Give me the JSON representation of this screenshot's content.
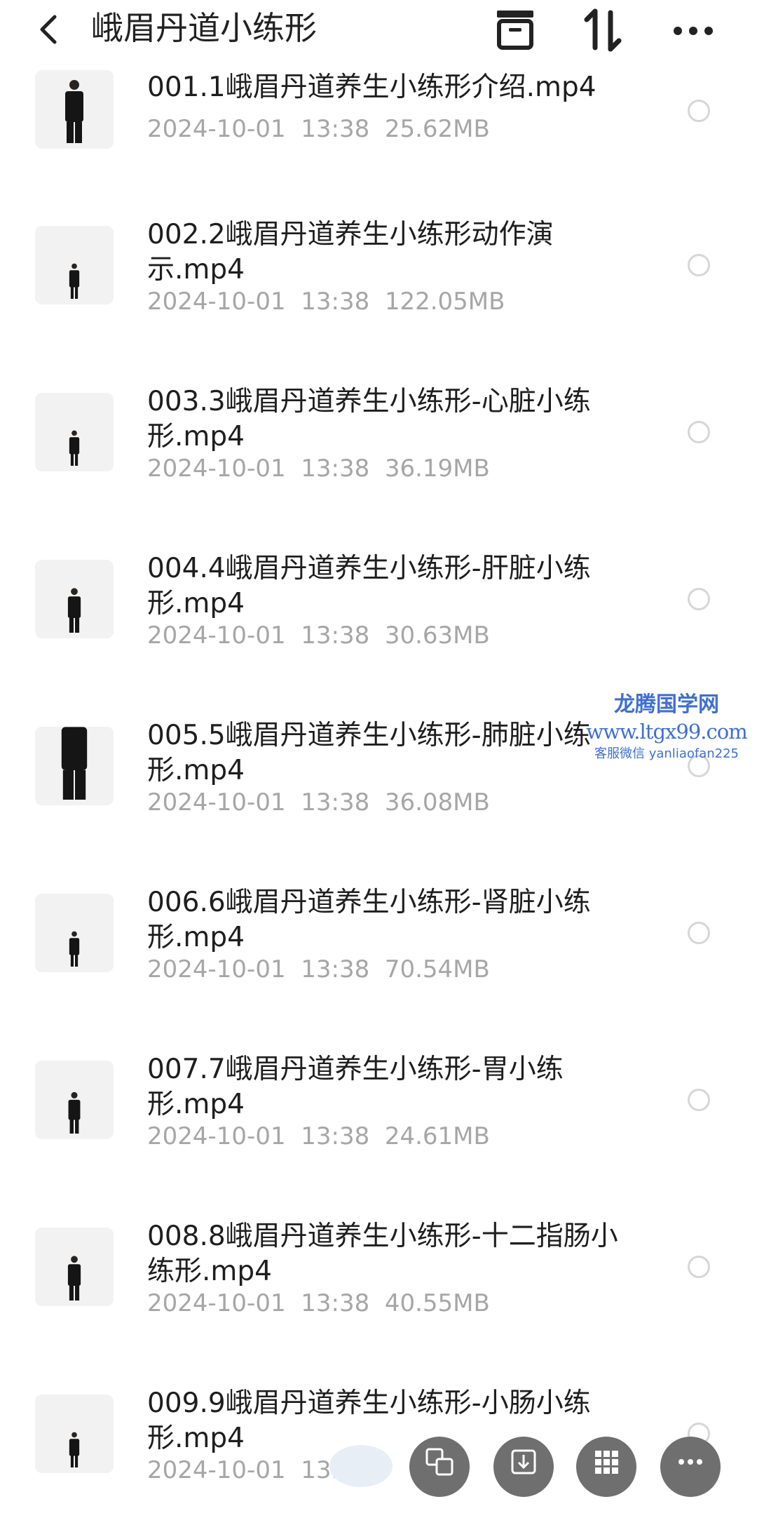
{
  "header": {
    "title": "峨眉丹道小练形",
    "icons": [
      "back-arrow-icon",
      "archive-box-icon",
      "sort-icon",
      "more-icon"
    ]
  },
  "files": [
    {
      "name": "001.1峨眉丹道养生小练形介绍.mp4",
      "date": "2024-10-01",
      "time": "13:38",
      "size": "25.62MB"
    },
    {
      "name": "002.2峨眉丹道养生小练形动作演示.mp4",
      "date": "2024-10-01",
      "time": "13:38",
      "size": "122.05MB"
    },
    {
      "name": "003.3峨眉丹道养生小练形-心脏小练形.mp4",
      "date": "2024-10-01",
      "time": "13:38",
      "size": "36.19MB"
    },
    {
      "name": "004.4峨眉丹道养生小练形-肝脏小练形.mp4",
      "date": "2024-10-01",
      "time": "13:38",
      "size": "30.63MB"
    },
    {
      "name": "005.5峨眉丹道养生小练形-肺脏小练形.mp4",
      "date": "2024-10-01",
      "time": "13:38",
      "size": "36.08MB"
    },
    {
      "name": "006.6峨眉丹道养生小练形-肾脏小练形.mp4",
      "date": "2024-10-01",
      "time": "13:38",
      "size": "70.54MB"
    },
    {
      "name": "007.7峨眉丹道养生小练形-胃小练形.mp4",
      "date": "2024-10-01",
      "time": "13:38",
      "size": "24.61MB"
    },
    {
      "name": "008.8峨眉丹道养生小练形-十二指肠小练形.mp4",
      "date": "2024-10-01",
      "time": "13:38",
      "size": "40.55MB"
    },
    {
      "name": "009.9峨眉丹道养生小练形-小肠小练形.mp4",
      "date": "2024-10-01",
      "time": "13:38",
      "size": ""
    }
  ],
  "watermark": {
    "line1": "龙腾国学网",
    "line2": "www.ltgx99.com",
    "line3": "客服微信 yanliaofan225"
  },
  "bottom_actions": [
    "translate-icon",
    "download-icon",
    "grid-icon",
    "more-icon"
  ],
  "colors": {
    "watermark": "#3f6fd0",
    "meta_text": "#a6a6a6",
    "fab": "#6f6f6f"
  }
}
